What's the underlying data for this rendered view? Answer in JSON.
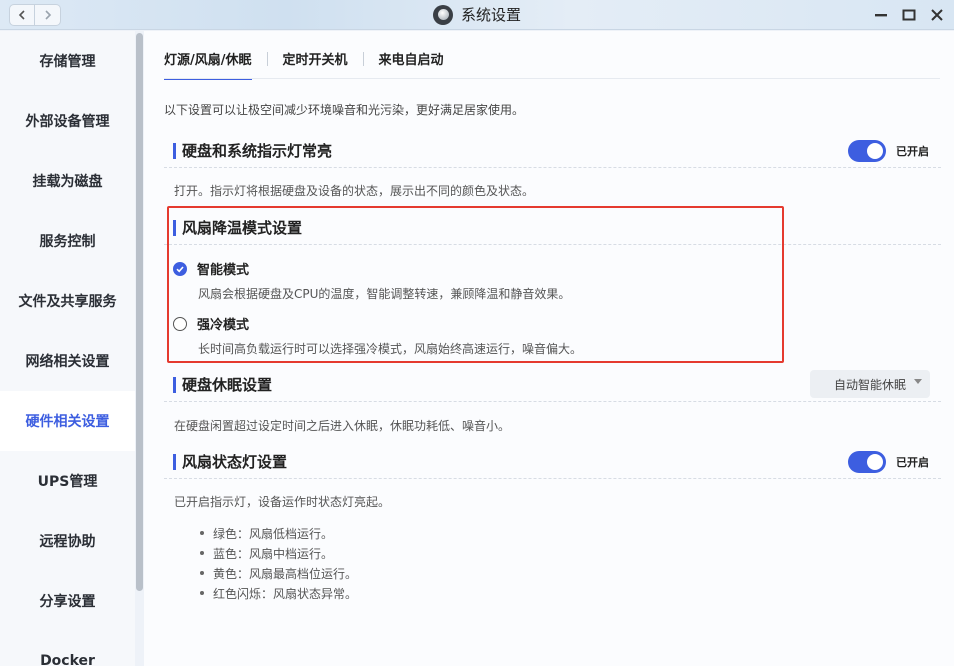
{
  "window": {
    "title": "系统设置"
  },
  "sidebar": {
    "items": [
      {
        "label": "存储管理"
      },
      {
        "label": "外部设备管理"
      },
      {
        "label": "挂载为磁盘"
      },
      {
        "label": "服务控制"
      },
      {
        "label": "文件及共享服务"
      },
      {
        "label": "网络相关设置"
      },
      {
        "label": "硬件相关设置",
        "active": true
      },
      {
        "label": "UPS管理"
      },
      {
        "label": "远程协助"
      },
      {
        "label": "分享设置"
      },
      {
        "label": "Docker"
      }
    ]
  },
  "tabs": [
    {
      "label": "灯源/风扇/休眠",
      "active": true
    },
    {
      "label": "定时开关机"
    },
    {
      "label": "来电自启动"
    }
  ],
  "intro": "以下设置可以让极空间减少环境噪音和光污染，更好满足居家使用。",
  "led_section": {
    "title": "硬盘和系统指示灯常亮",
    "toggle_on": true,
    "toggle_label": "已开启",
    "desc": "打开。指示灯将根据硬盘及设备的状态，展示出不同的颜色及状态。"
  },
  "fan_mode_section": {
    "title": "风扇降温模式设置",
    "options": [
      {
        "label": "智能模式",
        "checked": true,
        "desc": "风扇会根据硬盘及CPU的温度，智能调整转速，兼顾降温和静音效果。"
      },
      {
        "label": "强冷模式",
        "checked": false,
        "desc": "长时间高负载运行时可以选择强冷模式，风扇始终高速运行，噪音偏大。"
      }
    ]
  },
  "sleep_section": {
    "title": "硬盘休眠设置",
    "select_value": "自动智能休眠",
    "desc": "在硬盘闲置超过设定时间之后进入休眠，休眠功耗低、噪音小。"
  },
  "fan_led_section": {
    "title": "风扇状态灯设置",
    "toggle_on": true,
    "toggle_label": "已开启",
    "desc": "已开启指示灯，设备运作时状态灯亮起。",
    "bullets": [
      "绿色：风扇低档运行。",
      "蓝色：风扇中档运行。",
      "黄色：风扇最高档位运行。",
      "红色闪烁：风扇状态异常。"
    ]
  },
  "colors": {
    "accent": "#3d5ee0",
    "highlight": "#e53a2f"
  }
}
